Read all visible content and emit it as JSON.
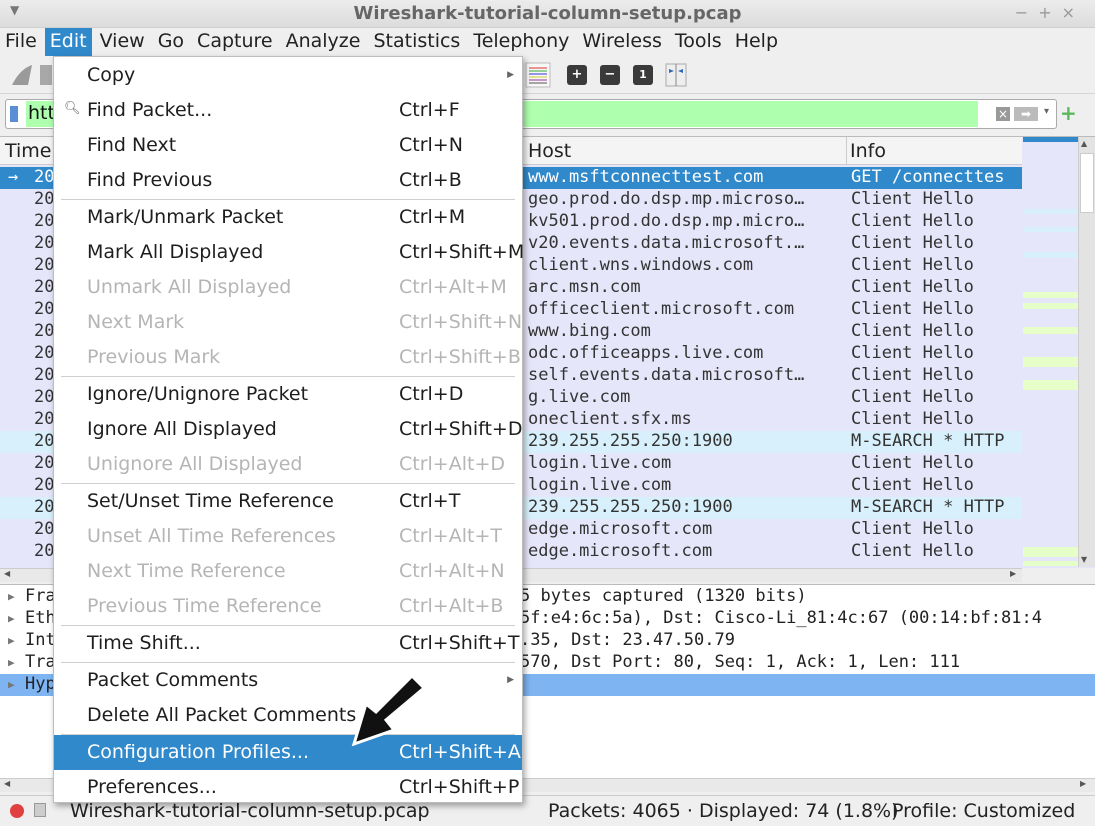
{
  "window": {
    "title": "Wireshark-tutorial-column-setup.pcap",
    "controls": [
      "−",
      "+",
      "×"
    ]
  },
  "menubar": {
    "items": [
      {
        "label": "File"
      },
      {
        "label": "Edit",
        "active": true
      },
      {
        "label": "View"
      },
      {
        "label": "Go"
      },
      {
        "label": "Capture"
      },
      {
        "label": "Analyze"
      },
      {
        "label": "Statistics"
      },
      {
        "label": "Telephony"
      },
      {
        "label": "Wireless"
      },
      {
        "label": "Tools"
      },
      {
        "label": "Help"
      }
    ]
  },
  "toolbar": {
    "icons": [
      "shark-fin-icon",
      "stop-icon",
      "colorize-icon",
      "zoom-in-icon",
      "zoom-out-icon",
      "normal-size-icon",
      "resize-columns-icon"
    ]
  },
  "filter": {
    "value": "htt",
    "clear_icon": "clear-icon",
    "apply_icon": "apply-arrow-icon",
    "add_icon": "plus-icon"
  },
  "packet_list": {
    "columns": [
      "Time",
      "Host",
      "Info"
    ],
    "rows": [
      {
        "time": "20",
        "host": "www.msftconnecttest.com",
        "info": "GET /connecttes",
        "selected": true
      },
      {
        "time": "20",
        "host": "geo.prod.do.dsp.mp.microso…",
        "info": "Client Hello"
      },
      {
        "time": "20",
        "host": "kv501.prod.do.dsp.mp.micro…",
        "info": "Client Hello"
      },
      {
        "time": "20",
        "host": "v20.events.data.microsoft.…",
        "info": "Client Hello"
      },
      {
        "time": "20",
        "host": "client.wns.windows.com",
        "info": "Client Hello"
      },
      {
        "time": "20",
        "host": "arc.msn.com",
        "info": "Client Hello"
      },
      {
        "time": "20",
        "host": "officeclient.microsoft.com",
        "info": "Client Hello"
      },
      {
        "time": "20",
        "host": "www.bing.com",
        "info": "Client Hello"
      },
      {
        "time": "20",
        "host": "odc.officeapps.live.com",
        "info": "Client Hello"
      },
      {
        "time": "20",
        "host": "self.events.data.microsoft…",
        "info": "Client Hello"
      },
      {
        "time": "20",
        "host": "g.live.com",
        "info": "Client Hello"
      },
      {
        "time": "20",
        "host": "oneclient.sfx.ms",
        "info": "Client Hello"
      },
      {
        "time": "20",
        "host": "239.255.255.250:1900",
        "info": "M-SEARCH * HTTP",
        "udp": true
      },
      {
        "time": "20",
        "host": "login.live.com",
        "info": "Client Hello"
      },
      {
        "time": "20",
        "host": "login.live.com",
        "info": "Client Hello"
      },
      {
        "time": "20",
        "host": "239.255.255.250:1900",
        "info": "M-SEARCH * HTTP",
        "udp": true
      },
      {
        "time": "20",
        "host": "edge.microsoft.com",
        "info": "Client Hello"
      },
      {
        "time": "20",
        "host": "edge.microsoft.com",
        "info": "Client Hello"
      }
    ]
  },
  "details": {
    "rows": [
      {
        "label": "Fra",
        "rest": "5 bytes captured (1320 bits)"
      },
      {
        "label": "Eth",
        "rest": "5f:e4:6c:5a), Dst: Cisco-Li_81:4c:67 (00:14:bf:81:4"
      },
      {
        "label": "Int",
        "rest": ".35, Dst: 23.47.50.79"
      },
      {
        "label": "Tra",
        "rest": "570, Dst Port: 80, Seq: 1, Ack: 1, Len: 111"
      },
      {
        "label": "Hyp",
        "rest": "",
        "highlighted": true
      }
    ]
  },
  "edit_menu": {
    "items": [
      {
        "label": "Copy",
        "shortcut": "",
        "submenu": true
      },
      {
        "label": "Find Packet...",
        "shortcut": "Ctrl+F",
        "icon": "search-icon"
      },
      {
        "label": "Find Next",
        "shortcut": "Ctrl+N"
      },
      {
        "label": "Find Previous",
        "shortcut": "Ctrl+B"
      },
      {
        "sep": true
      },
      {
        "label": "Mark/Unmark Packet",
        "shortcut": "Ctrl+M"
      },
      {
        "label": "Mark All Displayed",
        "shortcut": "Ctrl+Shift+M"
      },
      {
        "label": "Unmark All Displayed",
        "shortcut": "Ctrl+Alt+M",
        "disabled": true
      },
      {
        "label": "Next Mark",
        "shortcut": "Ctrl+Shift+N",
        "disabled": true
      },
      {
        "label": "Previous Mark",
        "shortcut": "Ctrl+Shift+B",
        "disabled": true
      },
      {
        "sep": true
      },
      {
        "label": "Ignore/Unignore Packet",
        "shortcut": "Ctrl+D"
      },
      {
        "label": "Ignore All Displayed",
        "shortcut": "Ctrl+Shift+D"
      },
      {
        "label": "Unignore All Displayed",
        "shortcut": "Ctrl+Alt+D",
        "disabled": true
      },
      {
        "sep": true
      },
      {
        "label": "Set/Unset Time Reference",
        "shortcut": "Ctrl+T"
      },
      {
        "label": "Unset All Time References",
        "shortcut": "Ctrl+Alt+T",
        "disabled": true
      },
      {
        "label": "Next Time Reference",
        "shortcut": "Ctrl+Alt+N",
        "disabled": true
      },
      {
        "label": "Previous Time Reference",
        "shortcut": "Ctrl+Alt+B",
        "disabled": true
      },
      {
        "sep": true
      },
      {
        "label": "Time Shift...",
        "shortcut": "Ctrl+Shift+T"
      },
      {
        "sep": true
      },
      {
        "label": "Packet Comments",
        "shortcut": "",
        "submenu": true
      },
      {
        "label": "Delete All Packet Comments",
        "shortcut": ""
      },
      {
        "sep": true
      },
      {
        "label": "Configuration Profiles...",
        "shortcut": "Ctrl+Shift+A",
        "highlighted": true
      },
      {
        "label": "Preferences...",
        "shortcut": "Ctrl+Shift+P"
      }
    ]
  },
  "statusbar": {
    "file": "Wireshark-tutorial-column-setup.pcap",
    "packets": "Packets: 4065 · Displayed: 74 (1.8%)",
    "profile": "Profile: Customized"
  },
  "colors": {
    "accent": "#3089cb",
    "filter_ok": "#aeffae",
    "row_tcp": "#e6e6fa",
    "row_udp": "#d8f0fb",
    "detail_hl": "#7eb4f2"
  }
}
